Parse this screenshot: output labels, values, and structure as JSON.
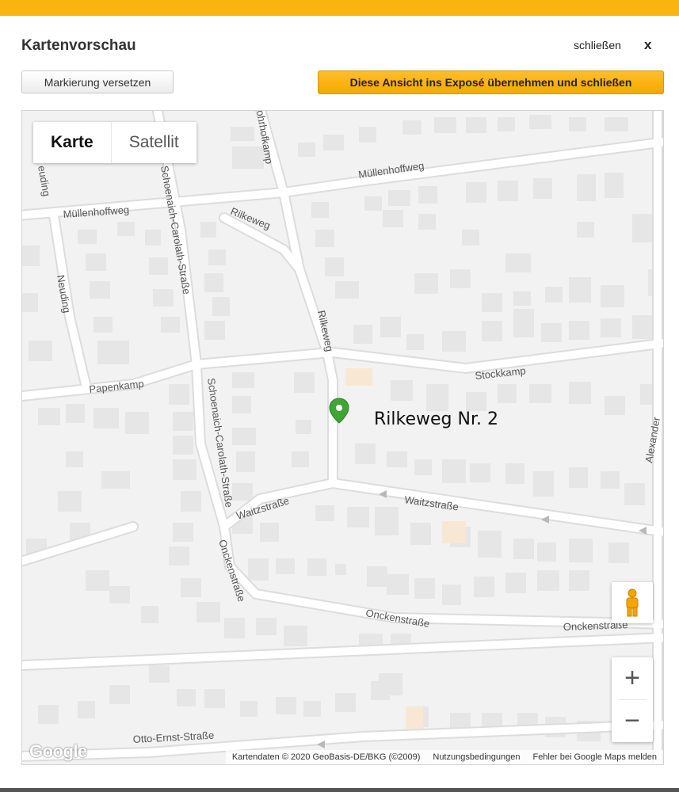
{
  "dialog": {
    "title": "Kartenvorschau",
    "close_label": "schließen",
    "close_x": "x"
  },
  "toolbar": {
    "move_marker_label": "Markierung versetzen",
    "apply_label": "Diese Ansicht ins Exposé übernehmen und schließen"
  },
  "map": {
    "map_type": {
      "map": "Karte",
      "satellite": "Satellit",
      "selected": "Karte"
    },
    "marker_label": "Rilkeweg  Nr. 2",
    "streets": {
      "ohrhofkamp": "ohrhofkamp",
      "muellenhoffweg_top": "Müllenhoffweg",
      "muellenhoffweg_left": "Müllenhoffweg",
      "neuding_top": "euding",
      "neuding": "Neuding",
      "rilkeweg_upper": "Rilkeweg",
      "rilkeweg_vertical": "Rilkeweg",
      "schoenaich_top": "Schoenaich-Carolath-Straße",
      "schoenaich_bottom": "Schoenaich-Carolath-Straße",
      "papenkamp": "Papenkamp",
      "stockkamp": "Stockkamp",
      "waitzstrasse_left": "Waitzstraße",
      "waitzstrasse_right": "Waitzstraße",
      "onckenstrasse_vertical": "Onckenstraße",
      "onckenstrasse_mid": "Onckenstraße",
      "onckenstrasse_right": "Onckenstraße",
      "alexander": "Alexander",
      "otto_ernst": "Otto-Ernst-Straße"
    },
    "controls": {
      "zoom_in": "+",
      "zoom_out": "−",
      "pegman_icon": "pegman-icon"
    },
    "google_logo": "Google",
    "attribution": {
      "data": "Kartendaten © 2020 GeoBasis-DE/BKG (©2009)",
      "terms": "Nutzungsbedingungen",
      "report": "Fehler bei Google Maps melden"
    }
  },
  "colors": {
    "accent_bar": "#f9b410",
    "apply_button": "#f4a900",
    "marker": "#3fa535"
  }
}
